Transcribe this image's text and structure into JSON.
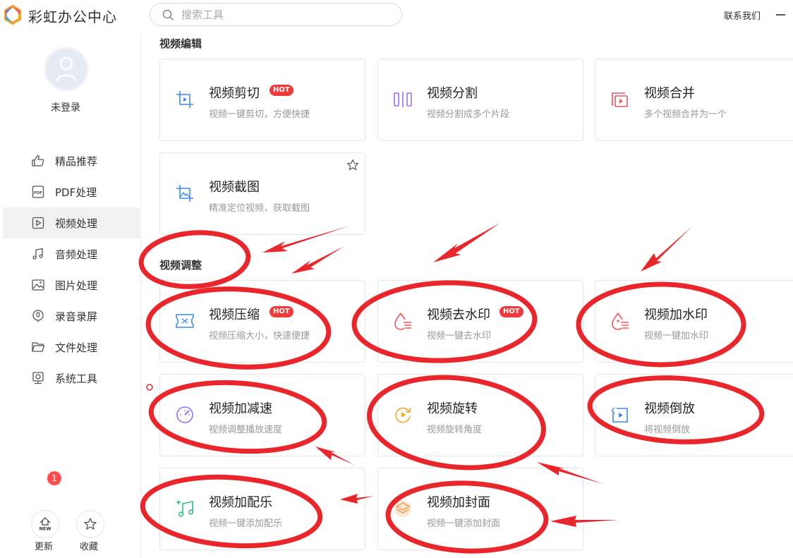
{
  "app": {
    "title": "彩虹办公中心"
  },
  "search": {
    "placeholder": "搜索工具"
  },
  "header": {
    "contact": "联系我们"
  },
  "user": {
    "login_label": "未登录"
  },
  "sidebar": {
    "items": [
      {
        "label": "精品推荐",
        "icon": "thumbs-up-icon"
      },
      {
        "label": "PDF处理",
        "icon": "pdf-icon"
      },
      {
        "label": "视频处理",
        "icon": "video-play-icon",
        "active": true
      },
      {
        "label": "音频处理",
        "icon": "music-note-icon"
      },
      {
        "label": "图片处理",
        "icon": "image-icon"
      },
      {
        "label": "录音录屏",
        "icon": "record-icon"
      },
      {
        "label": "文件处理",
        "icon": "folder-icon"
      },
      {
        "label": "系统工具",
        "icon": "monitor-icon"
      }
    ],
    "update_label": "更新",
    "update_badge": "1",
    "update_icon_text": "NEW",
    "favorite_label": "收藏"
  },
  "sections": {
    "edit_title": "视频编辑",
    "adjust_title": "视频调整"
  },
  "cards": {
    "cut": {
      "title": "视频剪切",
      "desc": "视频一键剪切，方便快捷",
      "hot": "HOT"
    },
    "split": {
      "title": "视频分割",
      "desc": "视频分割成多个片段"
    },
    "merge": {
      "title": "视频合并",
      "desc": "多个视频合并为一个"
    },
    "screenshot": {
      "title": "视频截图",
      "desc": "精准定位视频，获取截图"
    },
    "compress": {
      "title": "视频压缩",
      "desc": "视频压缩大小，快速便捷",
      "hot": "HOT"
    },
    "remove_watermark": {
      "title": "视频去水印",
      "desc": "视频一键去水印",
      "hot": "HOT"
    },
    "add_watermark": {
      "title": "视频加水印",
      "desc": "视频一键加水印"
    },
    "speed": {
      "title": "视频加减速",
      "desc": "视频调整播放速度"
    },
    "rotate": {
      "title": "视频旋转",
      "desc": "视频旋转角度"
    },
    "reverse": {
      "title": "视频倒放",
      "desc": "将视频倒放"
    },
    "music": {
      "title": "视频加配乐",
      "desc": "视频一键添加配乐"
    },
    "cover": {
      "title": "视频加封面",
      "desc": "视频一键添加封面"
    }
  },
  "colors": {
    "hot_badge": "#ee3a3a",
    "annotation_red": "#e8262b",
    "active_nav": "#f1f1f1"
  }
}
